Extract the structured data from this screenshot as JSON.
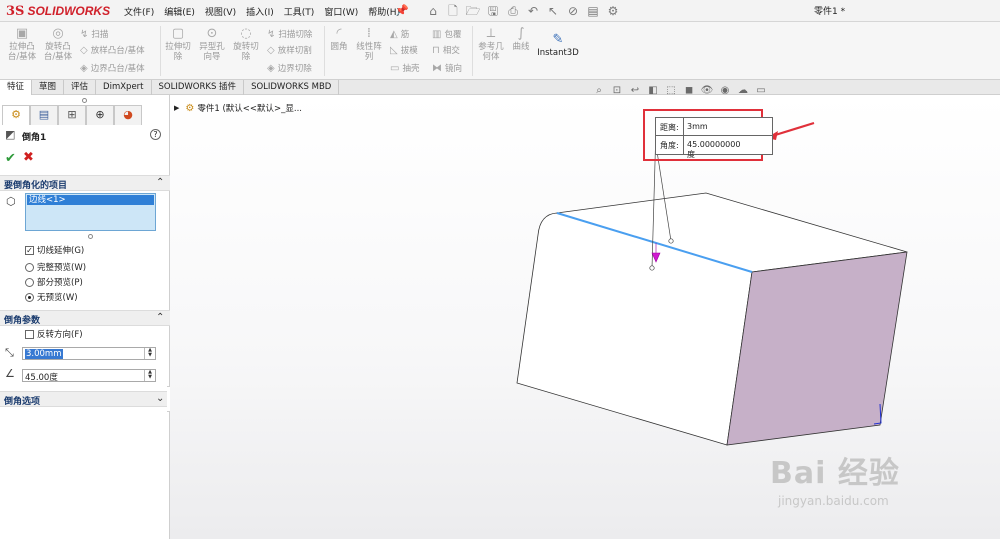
{
  "app": {
    "brand_ds": "3S",
    "brand_name": "SOLIDWORKS",
    "document_title": "零件1 *"
  },
  "menu": [
    "文件(F)",
    "编辑(E)",
    "视图(V)",
    "插入(I)",
    "工具(T)",
    "窗口(W)",
    "帮助(H)"
  ],
  "ribbon": {
    "extrude_boss": [
      "拉伸凸",
      "台/基体"
    ],
    "revolve_boss": [
      "旋转凸",
      "台/基体"
    ],
    "sweep": "扫描",
    "loft": "放样凸台/基体",
    "boundary_boss": "边界凸台/基体",
    "extrude_cut": [
      "拉伸切",
      "除"
    ],
    "hole_wizard": [
      "异型孔",
      "向导"
    ],
    "revolve_cut": [
      "旋转切",
      "除"
    ],
    "sweep_cut": "扫描切除",
    "loft_cut": "放样切割",
    "boundary_cut": "边界切除",
    "fillet": "圆角",
    "linear_pattern": [
      "线性阵",
      "列"
    ],
    "rib": "筋",
    "draft": "拔模",
    "shell": "抽壳",
    "wrap": "包覆",
    "intersect": "相交",
    "mirror": "镜向",
    "ref_geometry": [
      "参考几",
      "何体"
    ],
    "curves": "曲线",
    "instant3d": "Instant3D"
  },
  "tabs": [
    "特征",
    "草图",
    "评估",
    "DimXpert",
    "SOLIDWORKS 插件",
    "SOLIDWORKS MBD"
  ],
  "property_manager": {
    "title": "倒角1",
    "help": "?",
    "ok": "✔",
    "cancel": "✖",
    "section_items": "要倒角化的项目",
    "selected_item": "边线<1>",
    "tangent_propagation": "切线延伸(G)",
    "full_preview": "完整预览(W)",
    "partial_preview": "部分预览(P)",
    "no_preview": "无预览(W)",
    "section_params": "倒角参数",
    "flip_direction": "反转方向(F)",
    "distance_value": "3.00mm",
    "angle_value": "45.00度",
    "section_options": "倒角选项"
  },
  "tree": {
    "node_label": "零件1  (默认<<默认>_显..."
  },
  "callout": {
    "distance_label": "距离:",
    "distance_value": "3mm",
    "angle_label": "角度:",
    "angle_value": "45.00000000度"
  },
  "watermark": {
    "logo": "Bai 经验",
    "url": "jingyan.baidu.com"
  },
  "colors": {
    "brand_red": "#d0202a",
    "selection_blue": "#2f7fd6",
    "selected_edge": "#4a9ff0",
    "face_highlight": "#c6b0c8",
    "callout_red": "#e0303a"
  }
}
